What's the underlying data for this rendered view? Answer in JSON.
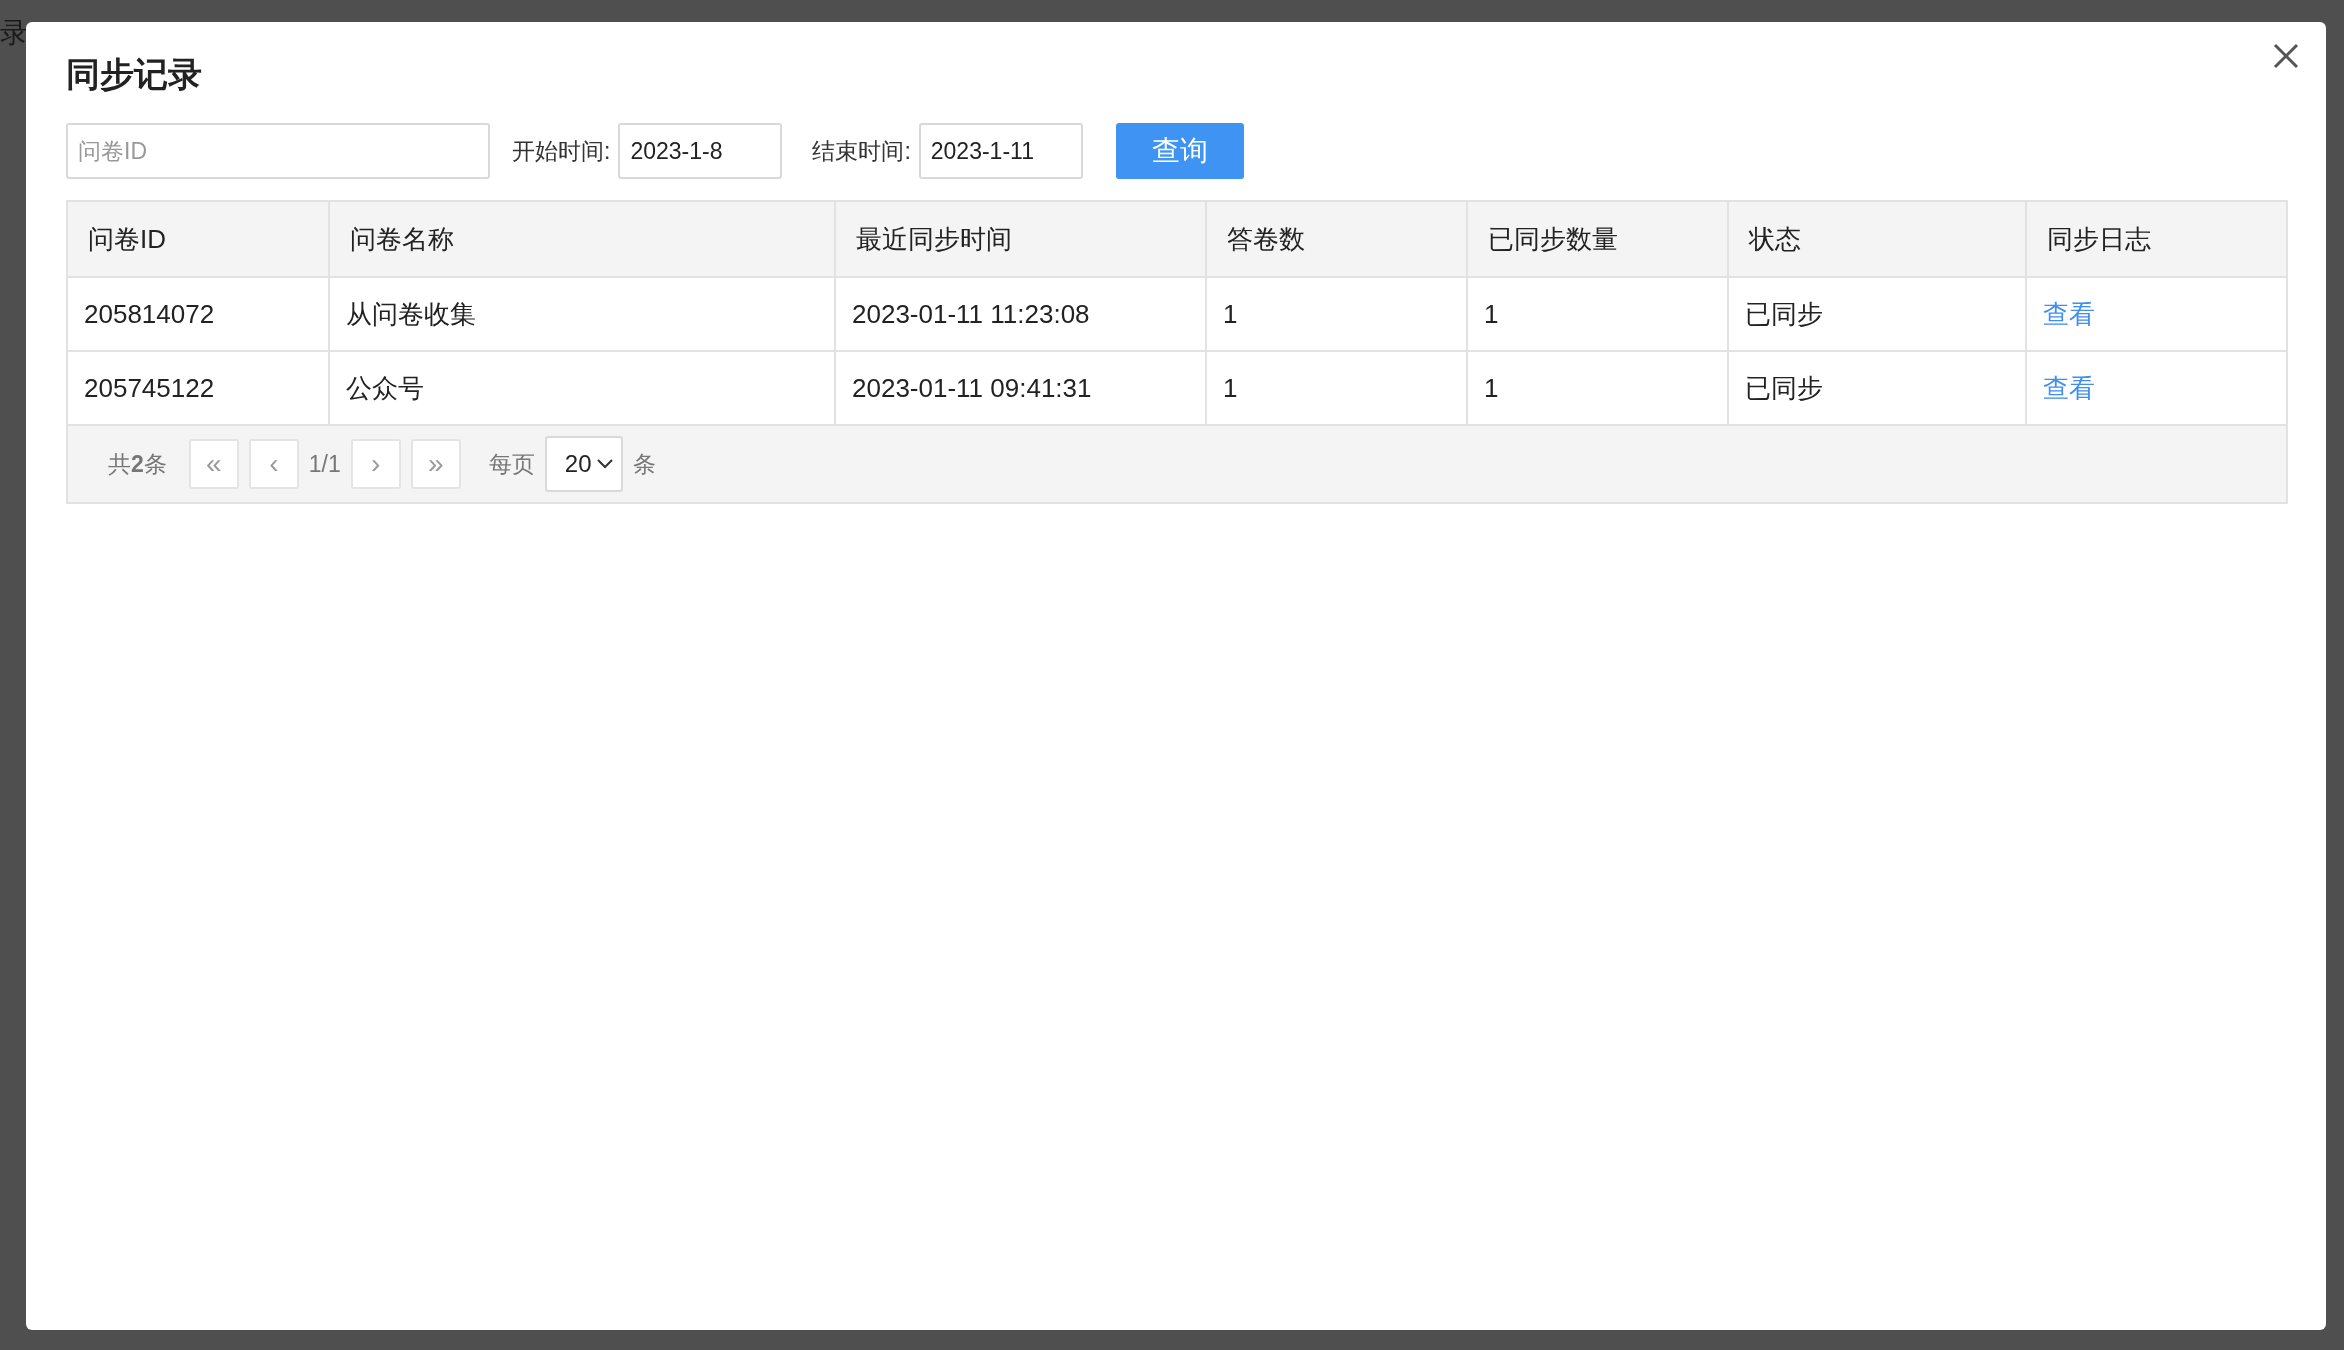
{
  "background": {
    "fragment": "录"
  },
  "dialog": {
    "title": "同步记录"
  },
  "filters": {
    "id_field": {
      "placeholder": "问卷ID"
    },
    "start": {
      "label": "开始时间:",
      "value": "2023-1-8"
    },
    "end": {
      "label": "结束时间:",
      "value": "2023-1-11"
    },
    "query_button": "查询"
  },
  "table": {
    "columns": [
      "问卷ID",
      "问卷名称",
      "最近同步时间",
      "答卷数",
      "已同步数量",
      "状态",
      "同步日志"
    ],
    "rows": [
      {
        "cells": [
          "205814072",
          "从问卷收集",
          "2023-01-11 11:23:08",
          "1",
          "1",
          "已同步"
        ],
        "link": "查看"
      },
      {
        "cells": [
          "205745122",
          "公众号",
          "2023-01-11 09:41:31",
          "1",
          "1",
          "已同步"
        ],
        "link": "查看"
      }
    ]
  },
  "pagination": {
    "total": "共**2**条",
    "first": "«",
    "prev": "‹",
    "page": "1/1",
    "next": "›",
    "last": "»",
    "per_page_label": "每页",
    "per_page": "20",
    "unit": "条"
  }
}
